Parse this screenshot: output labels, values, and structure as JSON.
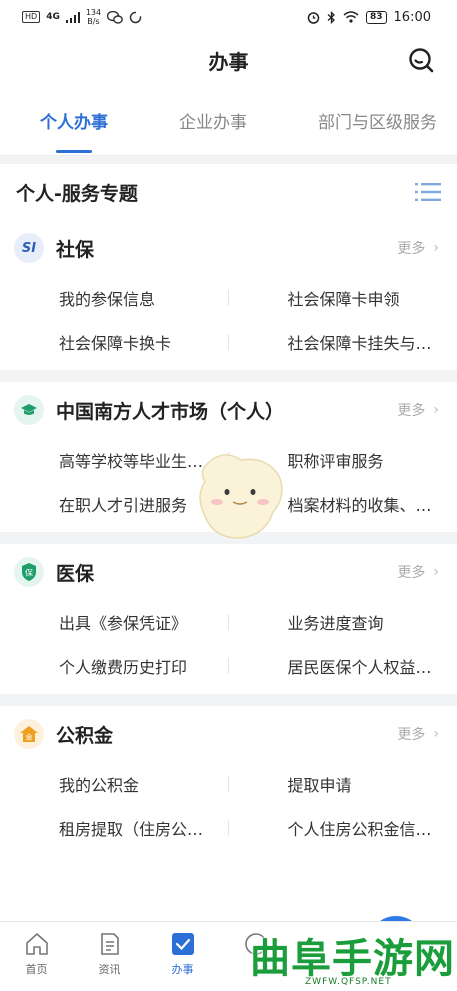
{
  "status_bar": {
    "network": "HD",
    "signal": "4G",
    "speed_value": "134",
    "speed_unit": "B/s",
    "battery": "83",
    "time": "16:00"
  },
  "header": {
    "title": "办事"
  },
  "tabs": [
    {
      "label": "个人办事",
      "active": true
    },
    {
      "label": "企业办事",
      "active": false
    },
    {
      "label": "部门与区级服务",
      "active": false
    }
  ],
  "section": {
    "title": "个人-服务专题"
  },
  "cards": [
    {
      "name": "社保",
      "icon": "si-logo-icon",
      "icon_text": "SI",
      "more_label": "更多",
      "items": [
        "我的参保信息",
        "社会保障卡申领",
        "社会保障卡换卡",
        "社会保障卡挂失与…"
      ]
    },
    {
      "name": "中国南方人才市场（个人）",
      "icon": "graduation-cap-icon",
      "more_label": "更多",
      "items": [
        "高等学校等毕业生…",
        "职称评审服务",
        "在职人才引进服务",
        "档案材料的收集、…"
      ]
    },
    {
      "name": "医保",
      "icon": "shield-icon",
      "icon_text": "保",
      "more_label": "更多",
      "items": [
        "出具《参保凭证》",
        "业务进度查询",
        "个人缴费历史打印",
        "居民医保个人权益…"
      ]
    },
    {
      "name": "公积金",
      "icon": "house-icon",
      "icon_text": "金",
      "more_label": "更多",
      "items": [
        "我的公积金",
        "提取申请",
        "租房提取（住房公…",
        "个人住房公积金信…"
      ]
    }
  ],
  "bottom_nav": [
    {
      "label": "首页",
      "icon": "home-icon",
      "active": false
    },
    {
      "label": "资讯",
      "icon": "news-icon",
      "active": false
    },
    {
      "label": "办事",
      "icon": "checkbox-icon",
      "active": true
    },
    {
      "label": "9",
      "icon": "circle-icon",
      "active": false
    }
  ],
  "watermark": {
    "text": "曲阜手游网",
    "url": "ZWFW.QFSP.NET"
  },
  "colors": {
    "accent": "#2d6fd6",
    "green": "#1a9d3a"
  }
}
